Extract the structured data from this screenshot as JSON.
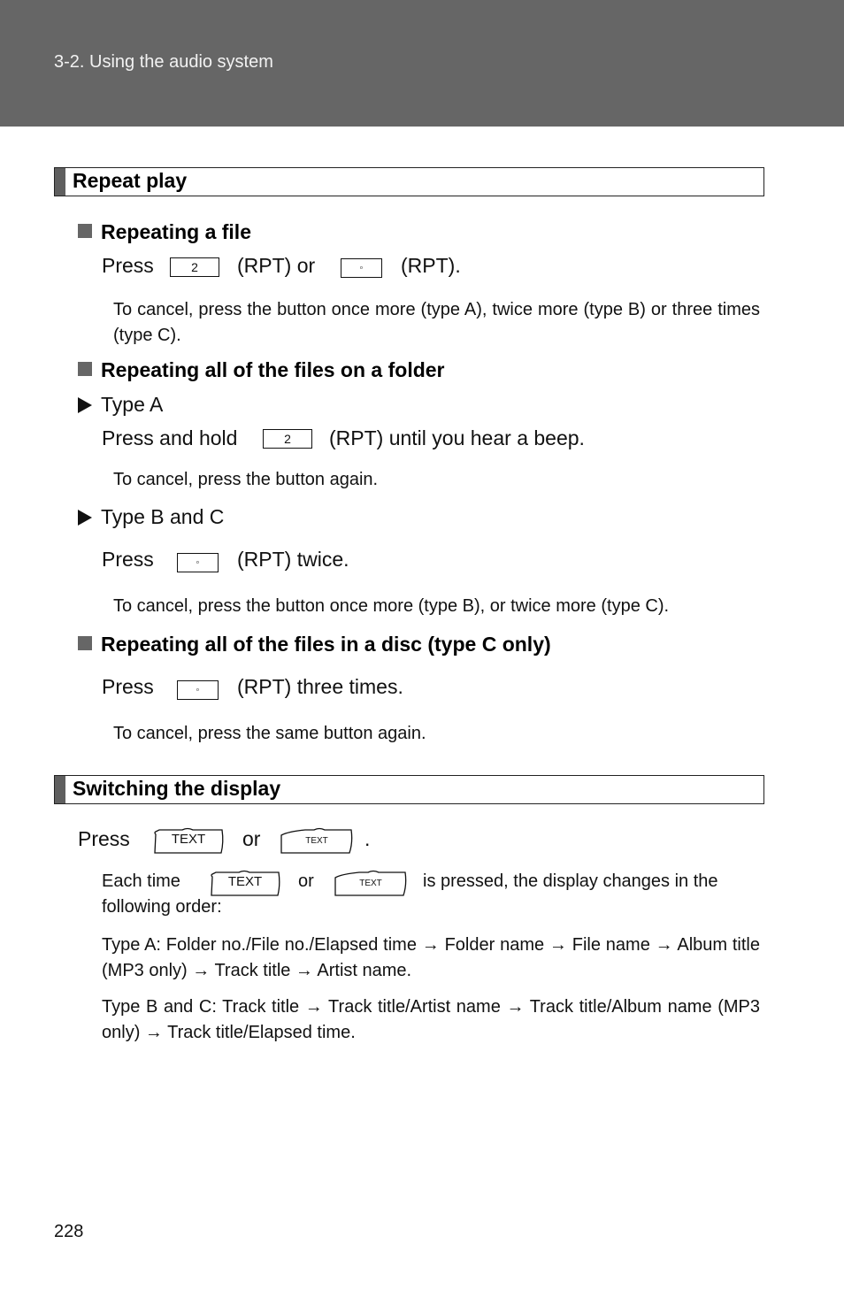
{
  "header": {
    "title": "3-2. Using the audio system"
  },
  "repeat_play": {
    "title": "Repeat play",
    "repeating_file": {
      "heading": "Repeating a file",
      "press": "Press",
      "key_2": "2",
      "rpt_or": "(RPT) or",
      "key_dot": "◦",
      "rpt_end": "(RPT).",
      "note": "To cancel, press the button once more (type A), twice more (type B) or three times (type C)."
    },
    "repeating_folder": {
      "heading": "Repeating all of the files on a folder",
      "type_a": {
        "label": "Type A",
        "press": "Press and hold",
        "key": "2",
        "suffix": "(RPT) until you hear a beep.",
        "note": "To cancel, press the button again."
      },
      "type_bc": {
        "label": "Type B and C",
        "press": "Press",
        "key": "◦",
        "suffix": "(RPT) twice.",
        "note": "To cancel, press the button once more (type B), or twice more (type C)."
      }
    },
    "repeating_disc": {
      "heading": "Repeating all of the files in a disc (type C only)",
      "press": "Press",
      "key": "◦",
      "suffix": "(RPT) three times.",
      "note": "To cancel, press the same button again."
    }
  },
  "switching_display": {
    "title": "Switching the display",
    "press": "Press",
    "key_text_large": "TEXT",
    "or": "or",
    "key_text_small": "TEXT",
    "period": ".",
    "each_time": "Each time",
    "each_or": "or",
    "each_suffix": "is pressed, the display changes in the",
    "each_line2": "following order:",
    "type_a_order": "Type A: Folder no./File no./Elapsed time → Folder name → File name → Album title (MP3 only) → Track title → Artist name.",
    "type_bc_order": "Type B and C: Track title → Track title/Artist name → Track title/Album name (MP3 only) → Track title/Elapsed time."
  },
  "page_number": "228"
}
